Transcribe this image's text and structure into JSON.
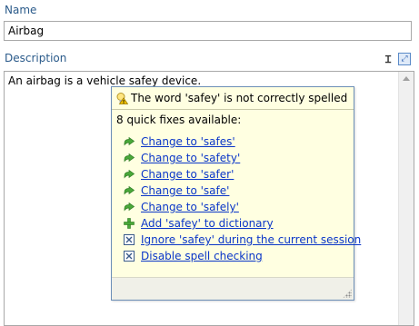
{
  "form": {
    "name_label": "Name",
    "name_value": "Airbag",
    "description_label": "Description",
    "description_text": "An airbag is a vehicle safey device."
  },
  "toolbar": {
    "format_icon": "text-format-icon",
    "expand_icon": "expand-icon"
  },
  "popup": {
    "title": "The word 'safey' is not correctly spelled",
    "fix_count_label": "8 quick fixes available:",
    "fixes": [
      {
        "label": "Change to 'safes'",
        "icon": "change-arrow-icon"
      },
      {
        "label": "Change to 'safety'",
        "icon": "change-arrow-icon"
      },
      {
        "label": "Change to 'safer'",
        "icon": "change-arrow-icon"
      },
      {
        "label": "Change to 'safe'",
        "icon": "change-arrow-icon"
      },
      {
        "label": "Change to 'safely'",
        "icon": "change-arrow-icon"
      },
      {
        "label": "Add 'safey' to dictionary",
        "icon": "add-plus-icon"
      },
      {
        "label": "Ignore 'safey' during the current session",
        "icon": "ignore-x-icon"
      },
      {
        "label": "Disable spell checking",
        "icon": "ignore-x-icon"
      }
    ]
  },
  "colors": {
    "label_blue": "#2a5a8a",
    "link_blue": "#0a36c8",
    "tooltip_bg": "#ffffe1",
    "arrow_green": "#3a9a2a"
  }
}
